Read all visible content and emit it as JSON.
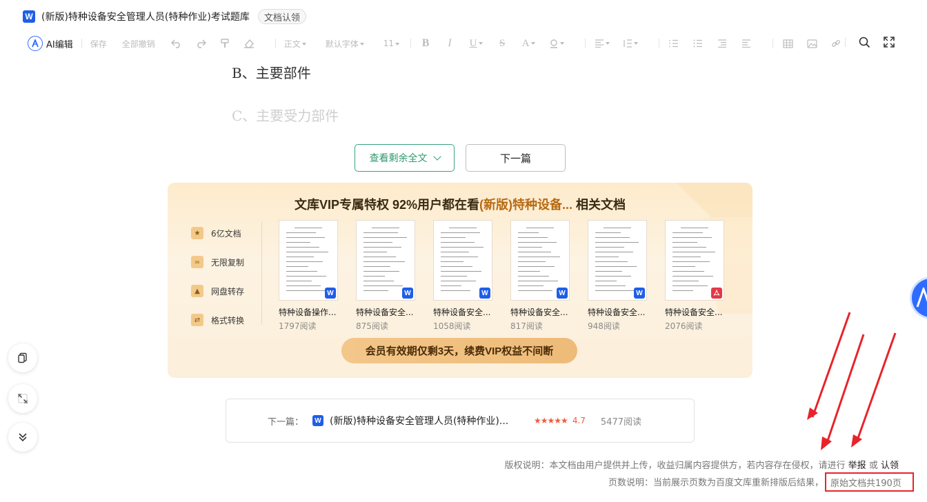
{
  "header": {
    "title": "(新版)特种设备安全管理人员(特种作业)考试题库",
    "claim_badge": "文档认领",
    "logo_letter": "W"
  },
  "toolbar": {
    "ai_label": "AI编辑",
    "save": "保存",
    "undo_all": "全部撤销",
    "style_dropdown": "正文",
    "font_dropdown": "默认字体",
    "size_dropdown": "11",
    "bold": "B",
    "italic": "I",
    "underline": "U",
    "strike": "S",
    "font_color": "A",
    "icons": [
      "undo-icon",
      "redo-icon",
      "format-painter-icon",
      "eraser-icon",
      "highlight-icon",
      "align-icon",
      "line-spacing-icon",
      "ordered-list-icon",
      "unordered-list-icon",
      "indent-decrease-icon",
      "indent-increase-icon",
      "table-icon",
      "image-icon",
      "link-icon",
      "search-icon",
      "fullscreen-icon"
    ]
  },
  "document": {
    "option_b": "B、主要部件",
    "option_c": "C、主要受力部件"
  },
  "actions": {
    "view_more": "查看剩余全文",
    "next_article": "下一篇"
  },
  "vip": {
    "title_prefix": "文库VIP专属特权 92%用户都在看",
    "title_highlight": "(新版)特种设备...",
    "title_suffix": " 相关文档",
    "benefits": [
      {
        "label": "6亿文档",
        "icon": "star-doc-icon"
      },
      {
        "label": "无限复制",
        "icon": "copy-icon"
      },
      {
        "label": "网盘转存",
        "icon": "cloud-save-icon"
      },
      {
        "label": "格式转换",
        "icon": "convert-icon"
      }
    ],
    "docs": [
      {
        "name": "特种设备操作...",
        "reads": "1797阅读",
        "type": "W"
      },
      {
        "name": "特种设备安全...",
        "reads": "875阅读",
        "type": "W"
      },
      {
        "name": "特种设备安全...",
        "reads": "1058阅读",
        "type": "W"
      },
      {
        "name": "特种设备安全...",
        "reads": "817阅读",
        "type": "W"
      },
      {
        "name": "特种设备安全...",
        "reads": "948阅读",
        "type": "W"
      },
      {
        "name": "特种设备安全...",
        "reads": "2076阅读",
        "type": "PDF"
      }
    ],
    "cta": "会员有效期仅剩3天，续费VIP权益不间断"
  },
  "next_card": {
    "label": "下一篇：",
    "title": "(新版)特种设备安全管理人员(特种作业)...",
    "stars": "★★★★★",
    "rating": "4.7",
    "reads": "5477阅读"
  },
  "footer": {
    "copyright": "版权说明：本文档由用户提供并上传，收益归属内容提供方，若内容存在侵权，请进行",
    "report": "举报",
    "or": "或",
    "claim": "认领",
    "pages_note": "页数说明：当前展示页数为百度文库重新排版后结果，",
    "original_pages": "原始文档共190页"
  },
  "colors": {
    "accent_blue": "#1f5ee8",
    "green": "#2e9a6e",
    "vip_gold": "#b76a12",
    "red_annotation": "#e8232a"
  }
}
